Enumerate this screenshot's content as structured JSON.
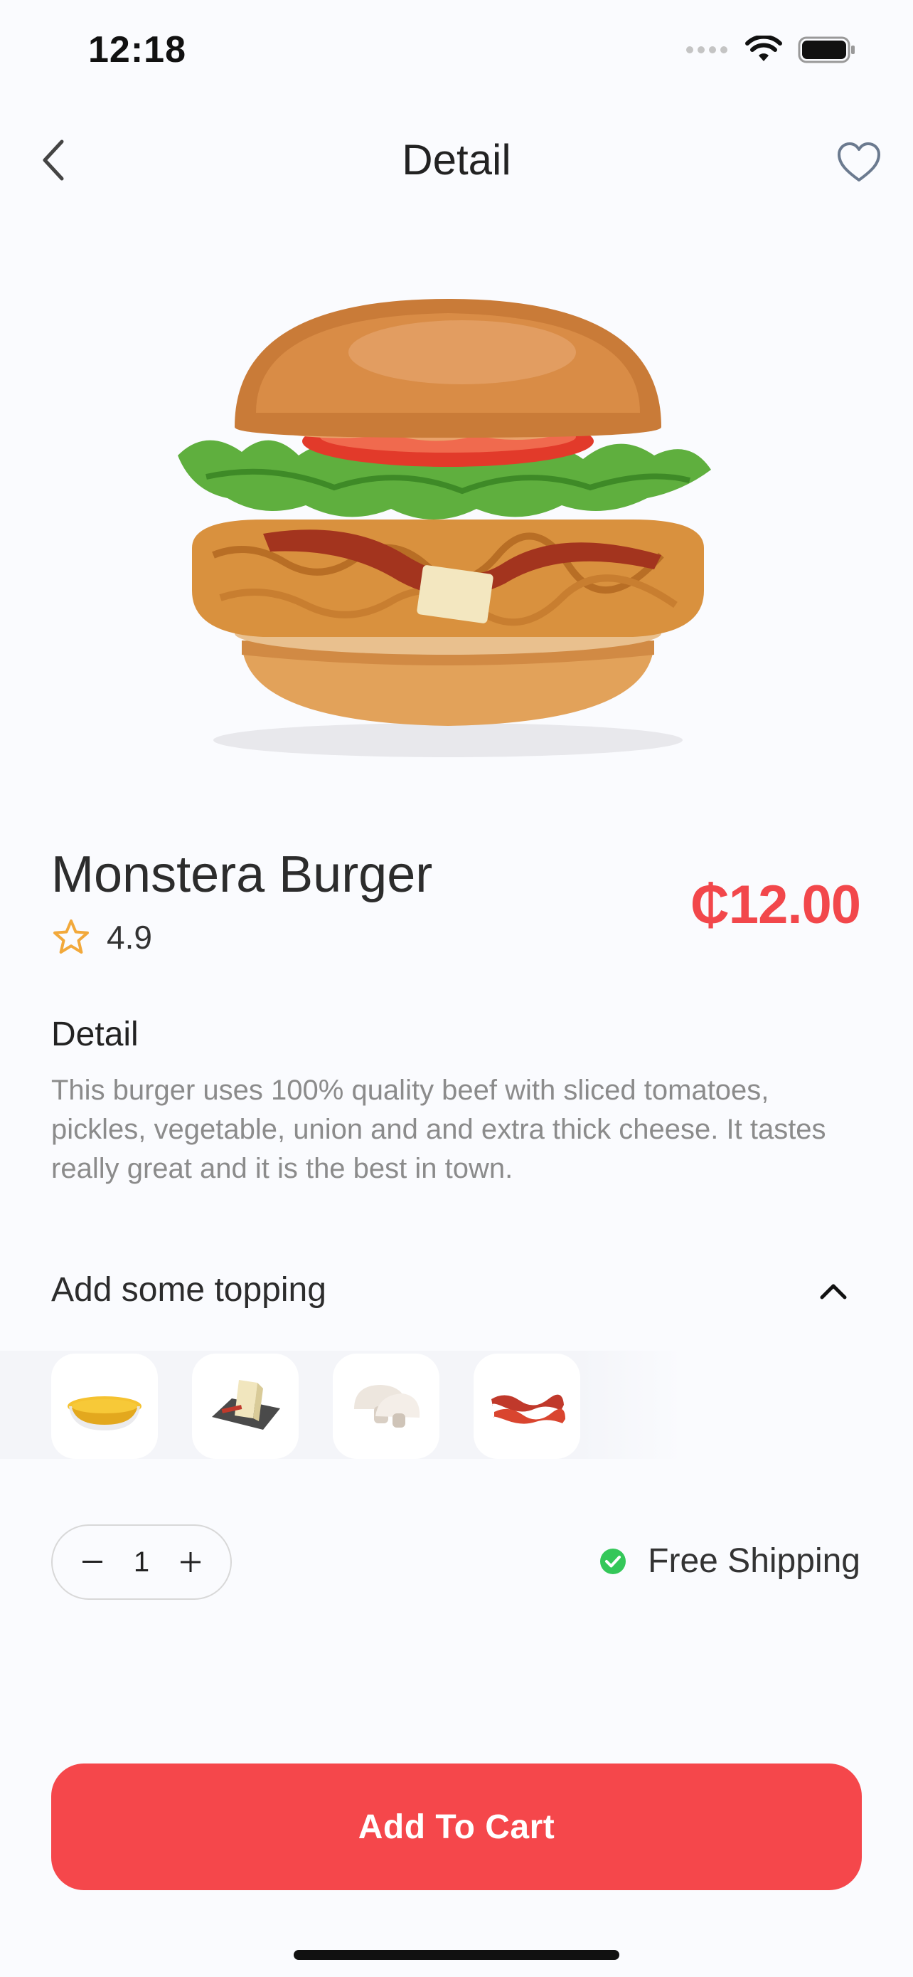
{
  "status_bar": {
    "time": "12:18"
  },
  "nav": {
    "title": "Detail"
  },
  "product": {
    "name": "Monstera Burger",
    "rating": "4.9",
    "price": "₵12.00"
  },
  "detail": {
    "heading": "Detail",
    "text": "This burger uses 100% quality beef with sliced tomatoes, pickles, vegetable, union and and extra thick cheese. It tastes really great and it is the best in town."
  },
  "topping": {
    "heading": "Add some topping",
    "items": [
      {
        "icon": "mustard-sauce-icon"
      },
      {
        "icon": "cheese-icon"
      },
      {
        "icon": "mushroom-icon"
      },
      {
        "icon": "bacon-icon"
      }
    ]
  },
  "quantity": {
    "value": "1"
  },
  "shipping": {
    "label": "Free Shipping"
  },
  "cart": {
    "label": "Add To Cart"
  },
  "colors": {
    "accent": "#F5474B",
    "price": "#F2474B",
    "star": "#F2A93B",
    "shipping_check": "#34C759",
    "background": "#FAFBFE"
  }
}
